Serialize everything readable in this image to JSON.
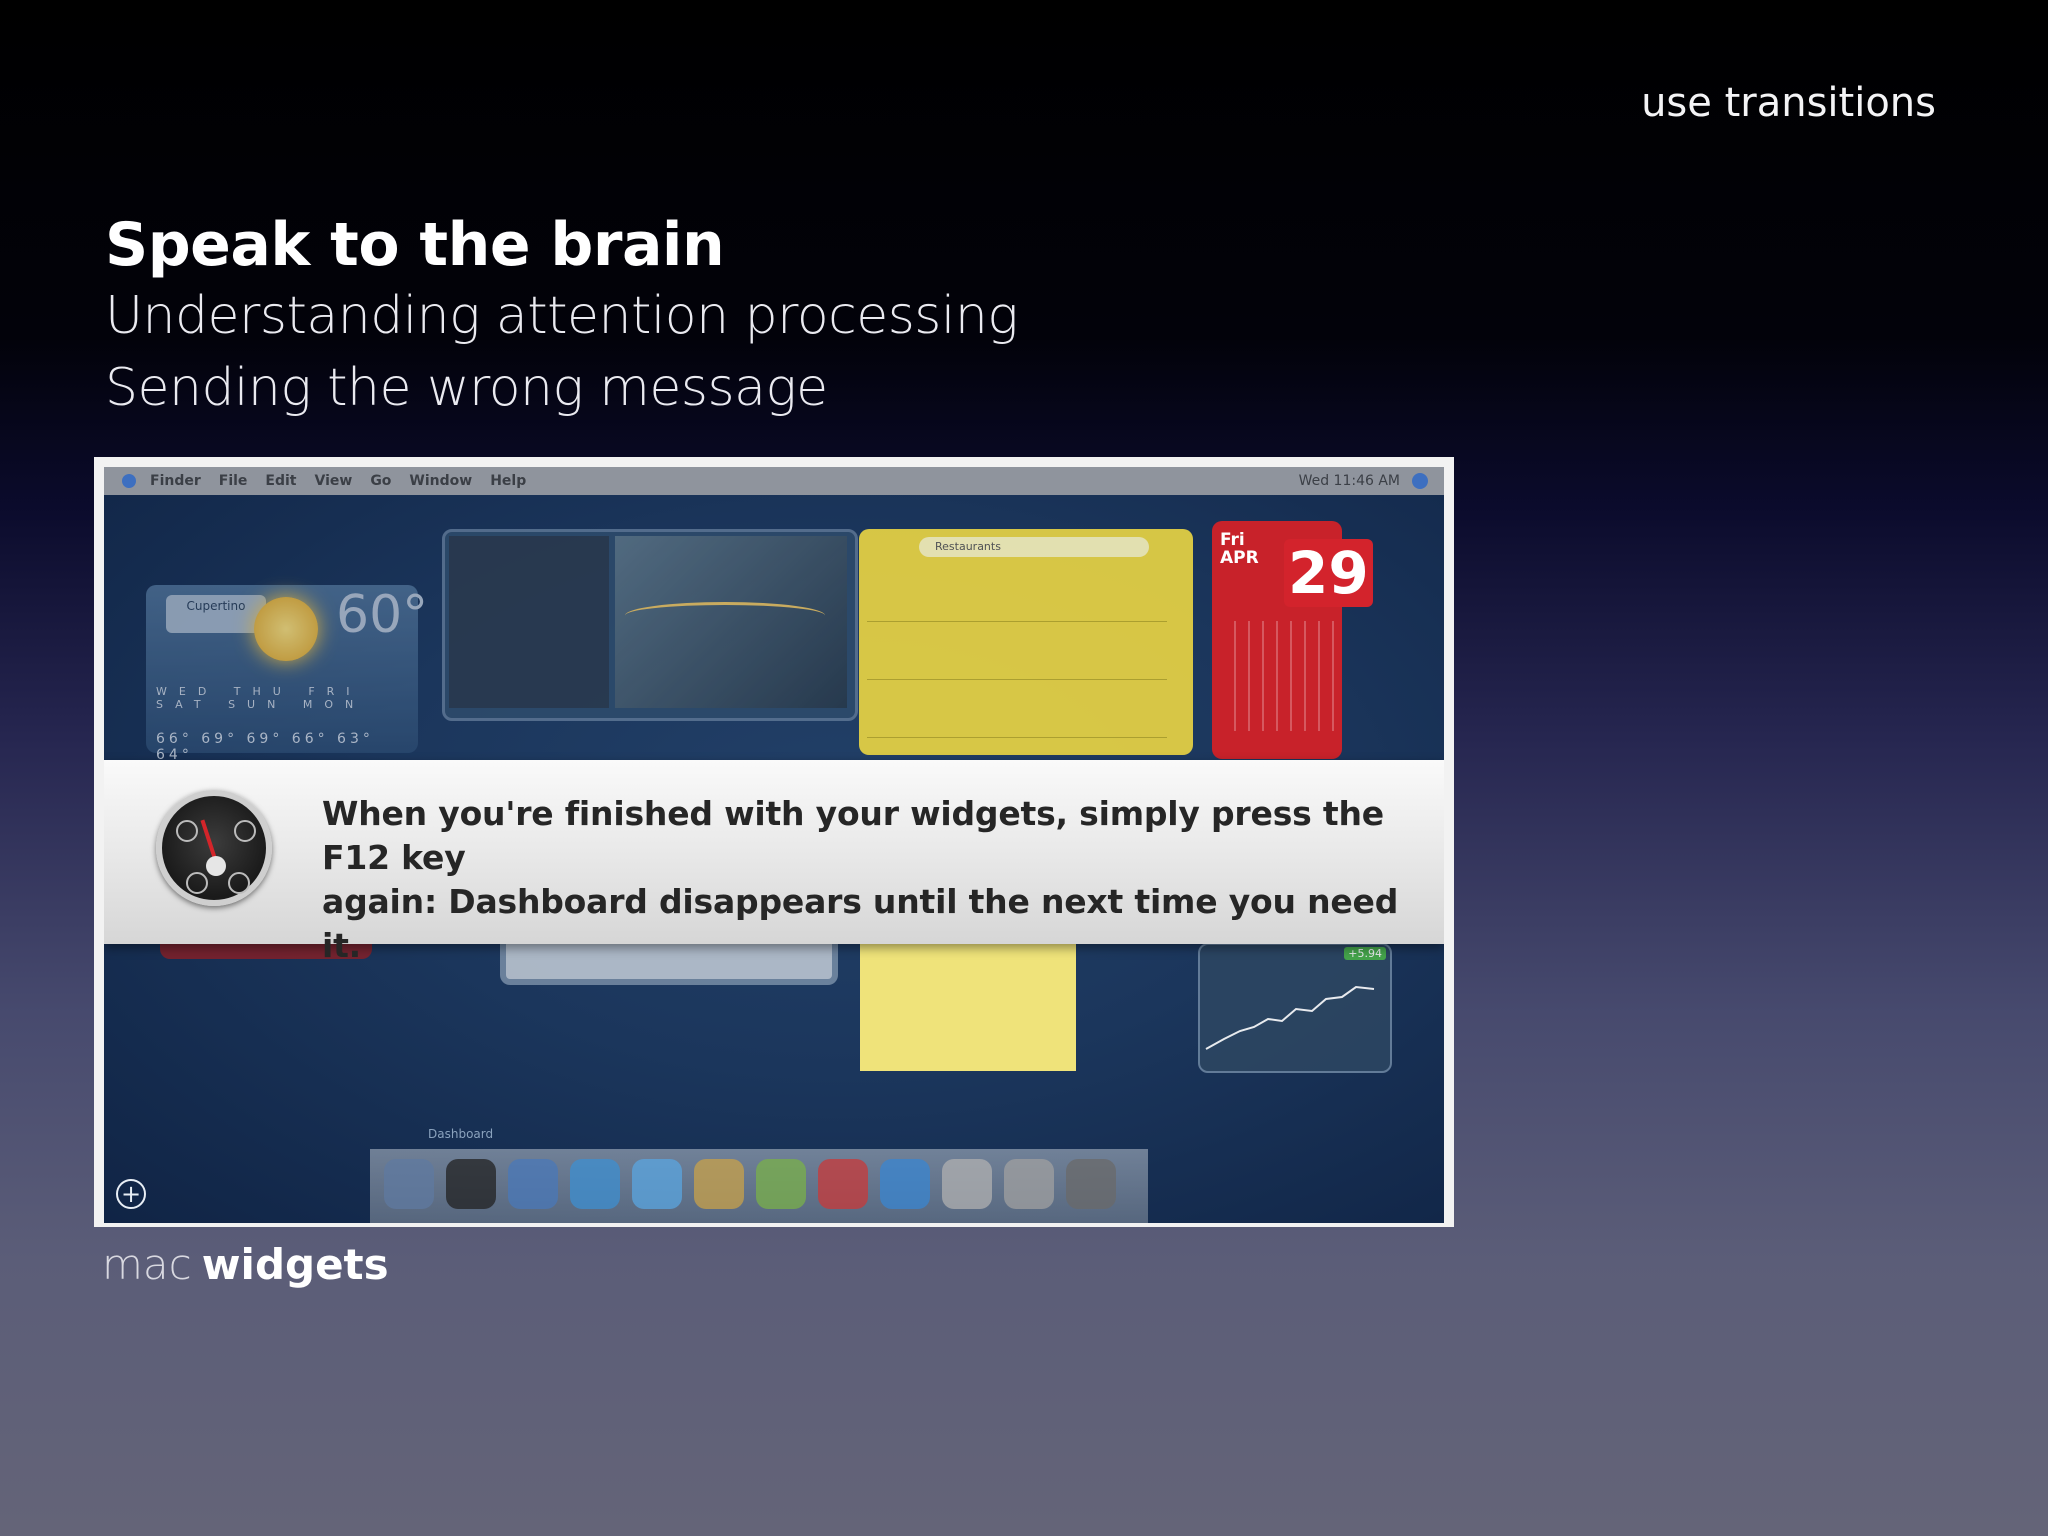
{
  "slide": {
    "corner_label": "use transitions",
    "title": "Speak to the brain",
    "subtitle_1": "Understanding attention processing",
    "subtitle_2": "Sending the wrong message",
    "caption_prefix": "mac",
    "caption_bold": "widgets"
  },
  "screenshot": {
    "menubar": {
      "items": [
        "Finder",
        "File",
        "Edit",
        "View",
        "Go",
        "Window",
        "Help"
      ],
      "clock": "Wed 11:46 AM"
    },
    "weather": {
      "city": "Cupertino",
      "temp": "60°",
      "days": "WED THU FRI SAT SUN MON",
      "temps": "66° 69° 69° 66° 63° 64°"
    },
    "restaurants": {
      "search_placeholder": "Restaurants"
    },
    "calendar": {
      "weekday": "Fri",
      "month": "APR",
      "day": "29"
    },
    "stocks": {
      "change": "+5.94"
    },
    "banner": {
      "message_line1": "When you're finished with your widgets, simply press the F12 key",
      "message_line2": "again: Dashboard disappears until the next time you need it."
    },
    "dock": {
      "label": "Dashboard",
      "add_symbol": "+"
    },
    "colors": {
      "dock_icons": [
        "#5f7aa0",
        "#222222",
        "#4a78b8",
        "#3d8fd0",
        "#5aa6e0",
        "#c8a24a",
        "#7ab04a",
        "#c83a3a",
        "#3a86d0",
        "#b0b0b0",
        "#a0a0a0",
        "#6a6a6a"
      ]
    }
  }
}
